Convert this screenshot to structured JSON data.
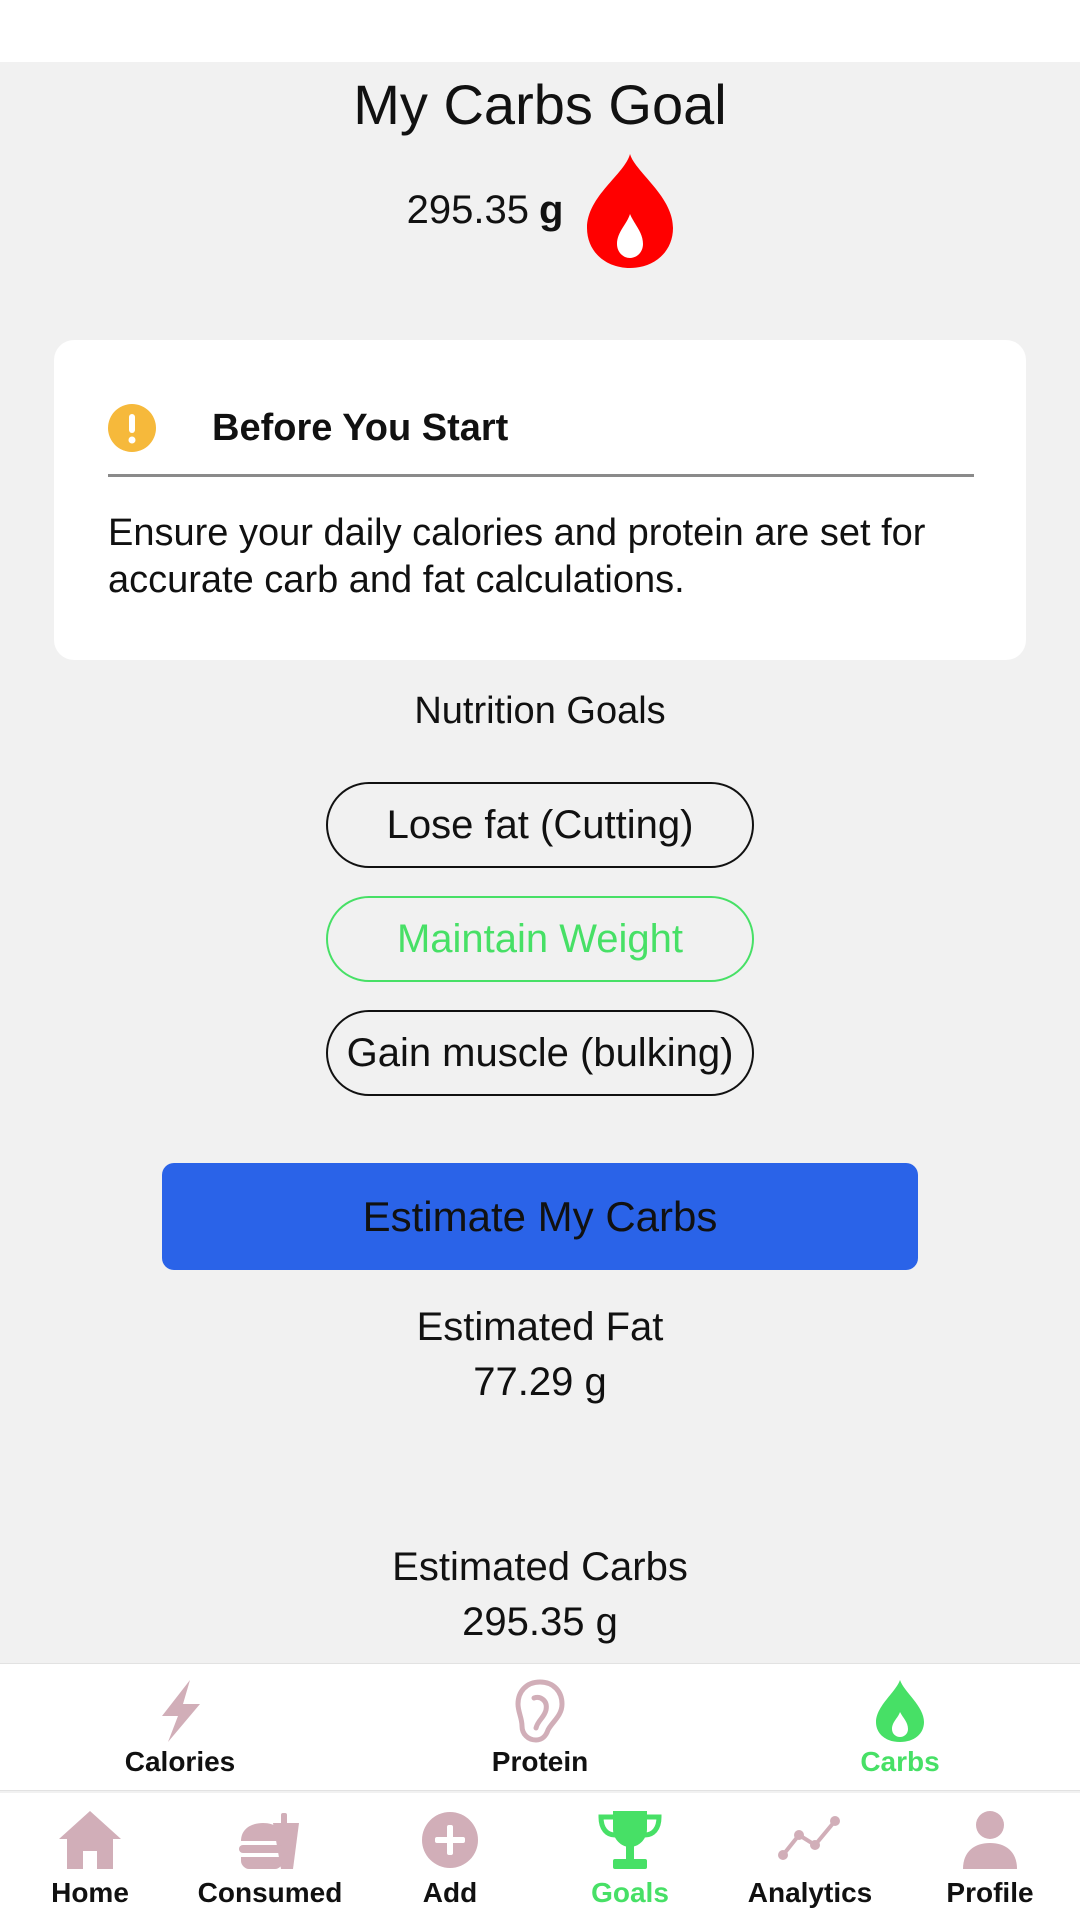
{
  "header": {
    "title": "My Carbs Goal",
    "goal_value": "295.35",
    "goal_unit": "g",
    "icon": "flame-icon"
  },
  "notice": {
    "icon": "warning-icon",
    "title": "Before You Start",
    "text": "Ensure your daily calories and protein are set for accurate carb and fat calculations."
  },
  "nutrition_goals": {
    "label": "Nutrition Goals",
    "options": [
      {
        "label": "Lose fat (Cutting)",
        "selected": false
      },
      {
        "label": "Maintain Weight",
        "selected": true
      },
      {
        "label": "Gain muscle (bulking)",
        "selected": false
      }
    ]
  },
  "estimate_button": "Estimate My Carbs",
  "results": {
    "fat_label": "Estimated Fat",
    "fat_value": "77.29 g",
    "carbs_label": "Estimated Carbs",
    "carbs_value": "295.35 g"
  },
  "sub_nav": {
    "active": "Carbs",
    "items": [
      {
        "label": "Calories",
        "icon": "lightning-icon"
      },
      {
        "label": "Protein",
        "icon": "protein-icon"
      },
      {
        "label": "Carbs",
        "icon": "flame-icon"
      }
    ]
  },
  "bottom_nav": {
    "active": "Goals",
    "items": [
      {
        "label": "Home",
        "icon": "home-icon"
      },
      {
        "label": "Consumed",
        "icon": "burger-icon"
      },
      {
        "label": "Add",
        "icon": "add-icon"
      },
      {
        "label": "Goals",
        "icon": "trophy-icon"
      },
      {
        "label": "Analytics",
        "icon": "chart-icon"
      },
      {
        "label": "Profile",
        "icon": "profile-icon"
      }
    ]
  },
  "colors": {
    "accent_green": "#47e066",
    "button_blue": "#2a63e8",
    "flame_red": "#ff0000",
    "warning_yellow": "#f6b93b",
    "icon_muted": "#d1aeb8"
  }
}
